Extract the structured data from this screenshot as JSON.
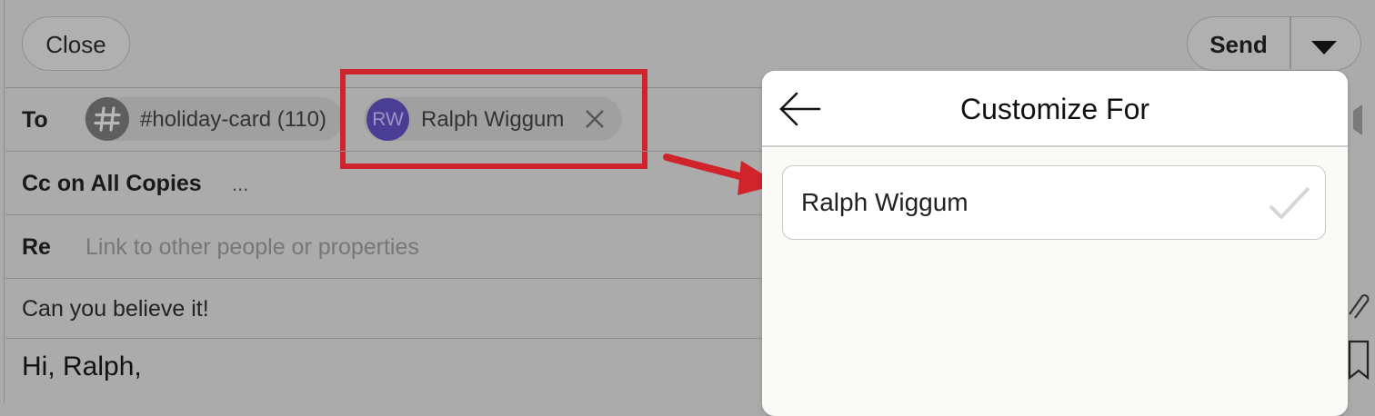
{
  "header": {
    "close_label": "Close",
    "send_label": "Send"
  },
  "to_row": {
    "label": "To",
    "recipients": [
      {
        "name": "#holiday-card (110)"
      },
      {
        "initials": "RW",
        "name": "Ralph Wiggum"
      }
    ]
  },
  "cc_row": {
    "label": "Cc on All Copies",
    "value": "..."
  },
  "re_row": {
    "label": "Re",
    "placeholder": "Link to other people or properties"
  },
  "subject": "Can you believe it!",
  "body": {
    "greeting": "Hi, Ralph,"
  },
  "customize_panel": {
    "title": "Customize For",
    "options": [
      {
        "name": "Ralph Wiggum",
        "checked": false
      }
    ]
  },
  "colors": {
    "annotation_red": "#d0242c",
    "avatar_purple": "#4a3e94"
  }
}
